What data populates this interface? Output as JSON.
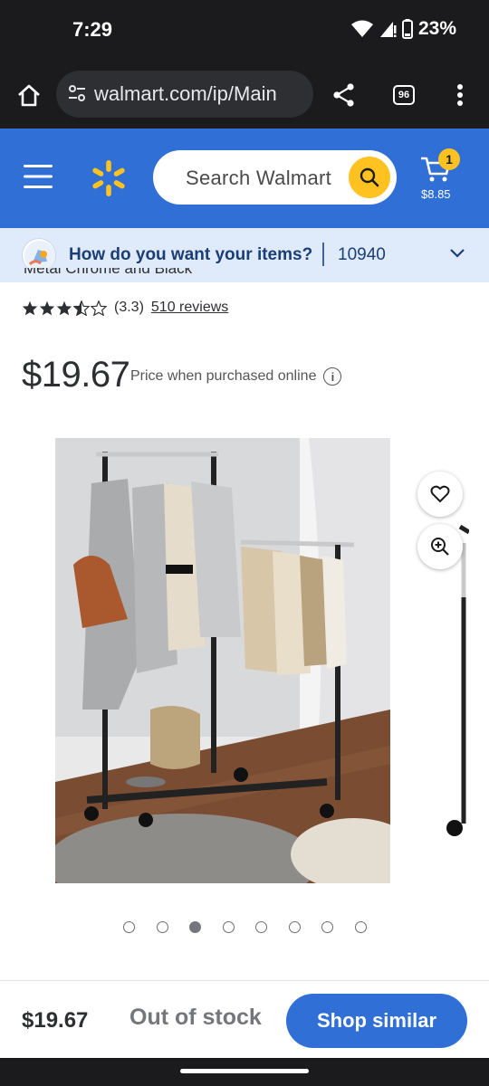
{
  "status_bar": {
    "time": "7:29",
    "battery": "23%"
  },
  "browser": {
    "url": "walmart.com/ip/Main",
    "tab_count": "96"
  },
  "header": {
    "search_placeholder": "Search Walmart",
    "cart_count": "1",
    "cart_total": "$8.85",
    "brand_color": "#2f6fd6",
    "accent_color": "#ffc220"
  },
  "delivery": {
    "question": "How do you want your items?",
    "zip": "10940"
  },
  "product": {
    "title_fragment": "Metal Chrome and Black",
    "rating": 3.3,
    "rating_text": "(3.3)",
    "reviews_text": "510 reviews",
    "price": "$19.67",
    "price_note": "Price when purchased online",
    "image_count": 8,
    "active_image_index": 2
  },
  "bottom_bar": {
    "price": "$19.67",
    "status": "Out of stock",
    "action_label": "Shop similar"
  }
}
